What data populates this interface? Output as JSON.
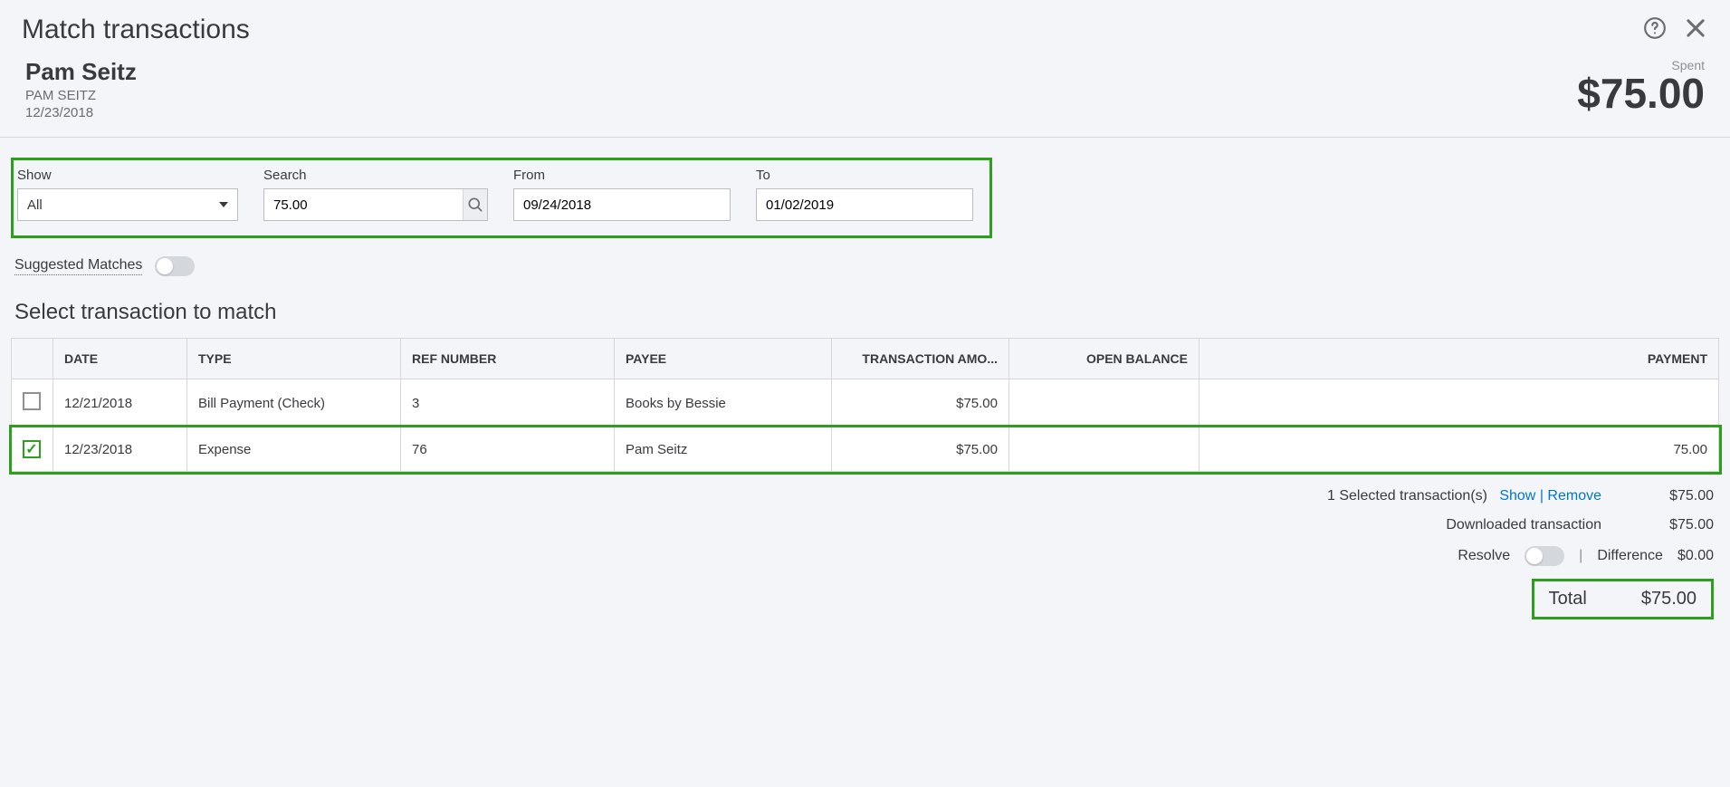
{
  "header": {
    "title": "Match transactions"
  },
  "account": {
    "name": "Pam Seitz",
    "subtitle": "PAM SEITZ",
    "date": "12/23/2018",
    "spent_label": "Spent",
    "spent_amount": "$75.00"
  },
  "filters": {
    "show_label": "Show",
    "show_value": "All",
    "search_label": "Search",
    "search_value": "75.00",
    "from_label": "From",
    "from_value": "09/24/2018",
    "to_label": "To",
    "to_value": "01/02/2019"
  },
  "suggested": {
    "label": "Suggested Matches",
    "on": false
  },
  "table": {
    "heading": "Select transaction to match",
    "columns": {
      "date": "DATE",
      "type": "TYPE",
      "ref": "REF NUMBER",
      "payee": "PAYEE",
      "amount": "TRANSACTION AMO...",
      "balance": "OPEN BALANCE",
      "payment": "PAYMENT"
    },
    "rows": [
      {
        "checked": false,
        "date": "12/21/2018",
        "type": "Bill Payment (Check)",
        "ref": "3",
        "payee": "Books by Bessie",
        "amount": "$75.00",
        "balance": "",
        "payment": "",
        "highlight": false
      },
      {
        "checked": true,
        "date": "12/23/2018",
        "type": "Expense",
        "ref": "76",
        "payee": "Pam Seitz",
        "amount": "$75.00",
        "balance": "",
        "payment": "75.00",
        "highlight": true
      }
    ]
  },
  "summary": {
    "selected_prefix": "1 Selected transaction(s)",
    "show_link": "Show",
    "remove_link": "Remove",
    "selected_value": "$75.00",
    "downloaded_label": "Downloaded transaction",
    "downloaded_value": "$75.00",
    "resolve_label": "Resolve",
    "difference_label": "Difference",
    "difference_value": "$0.00",
    "total_label": "Total",
    "total_value": "$75.00"
  }
}
